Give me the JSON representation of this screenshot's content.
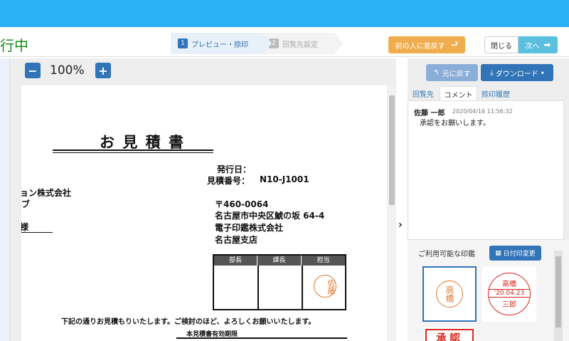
{
  "header": {
    "status_text": "行中",
    "steps": [
      {
        "num": "1",
        "label": "プレビュー・捺印"
      },
      {
        "num": "2",
        "label": "回覧先設定"
      }
    ],
    "send_back_label": "前の人に差戻す",
    "close_label": "閉じる",
    "next_label": "次へ"
  },
  "viewer": {
    "zoom_out": "−",
    "zoom_value": "100%",
    "zoom_in": "+"
  },
  "document": {
    "title": "お 見 積 書",
    "issue_date_label": "発行日：",
    "estimate_no_label": "見積番号：",
    "estimate_no": "N10-J1001",
    "recipient_line1": "ョン株式会社",
    "recipient_line2": "ブ",
    "recipient_line3": "様",
    "postal": "〒460-0064",
    "address": "名古屋市中央区鯱の坂 64-4",
    "company": "電子印鑑株式会社",
    "branch": "名古屋支店",
    "stamp_headers": [
      "部長",
      "課長",
      "担当"
    ],
    "applied_stamp_text": "佐藤",
    "body_text": "下記の通りお見積もりいたします。ご検討のほど、よろしくお願いいたします。",
    "validity_label": "本見積書有効期限"
  },
  "right_panel": {
    "undo_label": "元に戻す",
    "download_label": "ダウンロード",
    "tabs": [
      "回覧先",
      "コメント",
      "捺印履歴"
    ],
    "comment": {
      "author": "佐藤 一郎",
      "timestamp": "2020/04/16 11:56:32",
      "text": "承認をお願いします。"
    },
    "stamps_title": "ご利用可能な印鑑",
    "date_change_label": "日付印変更",
    "stamp1_text": "高橋",
    "stamp2_top": "高橋",
    "stamp2_date": "'20.04.23",
    "stamp2_bottom": "三郎",
    "stamp3_text": "承認"
  },
  "colors": {
    "topbar": "#2ab0f5",
    "primary": "#3174b8",
    "warning": "#f0ad4e",
    "info": "#5bc0de",
    "stamp_orange": "#e07a2e",
    "stamp_red": "#d9251c"
  }
}
